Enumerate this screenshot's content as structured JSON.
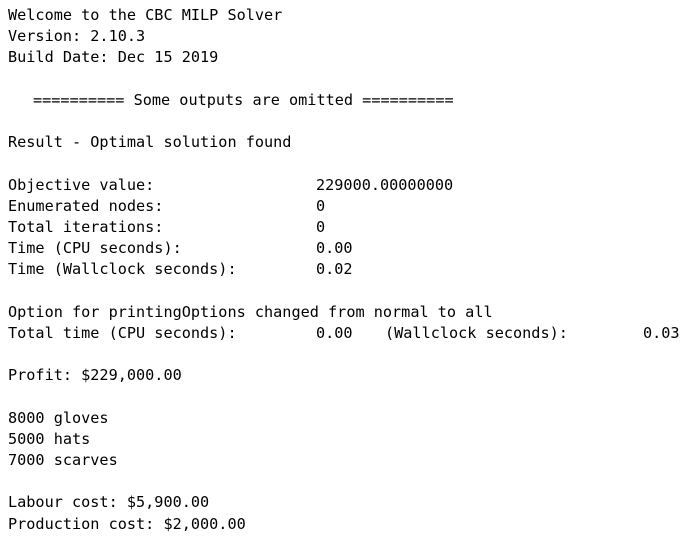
{
  "header": {
    "welcome": "Welcome to the CBC MILP Solver",
    "version": "Version: 2.10.3",
    "build_date": "Build Date: Dec 15 2019"
  },
  "omitted_notice": "========== Some outputs are omitted ==========",
  "result": "Result - Optimal solution found",
  "stats": [
    {
      "label": "Objective value:",
      "value": "229000.00000000"
    },
    {
      "label": "Enumerated nodes:",
      "value": "0"
    },
    {
      "label": "Total iterations:",
      "value": "0"
    },
    {
      "label": "Time (CPU seconds):",
      "value": "0.00"
    },
    {
      "label": "Time (Wallclock seconds):",
      "value": "0.02"
    }
  ],
  "option_change": "Option for printingOptions changed from normal to all",
  "total_time": {
    "label": "Total time (CPU seconds):",
    "cpu_value": "0.00",
    "wallclock_label": "(Wallclock seconds):",
    "wallclock_value": "0.03"
  },
  "profit": "Profit: $229,000.00",
  "products": [
    "8000 gloves",
    "5000 hats",
    "7000 scarves"
  ],
  "costs": {
    "labour": "Labour cost: $5,900.00",
    "production": "Production cost: $2,000.00"
  }
}
